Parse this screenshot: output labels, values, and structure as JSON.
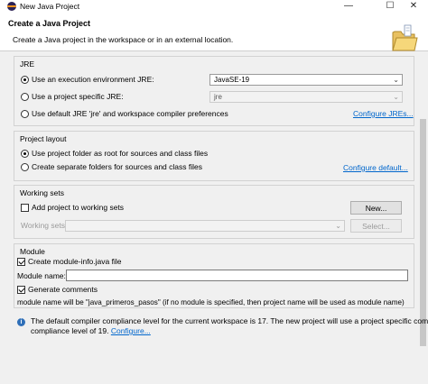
{
  "window": {
    "title": "New Java Project",
    "controls": {
      "minimize": "—",
      "maximize": "☐",
      "close": "✕"
    }
  },
  "header": {
    "title": "Create a Java Project",
    "description": "Create a Java project in the workspace or in an external location."
  },
  "jre": {
    "group_label": "JRE",
    "options": [
      {
        "label": "Use an execution environment JRE:",
        "selected": true
      },
      {
        "label": "Use a project specific JRE:",
        "selected": false
      },
      {
        "label": "Use default JRE 'jre' and workspace compiler preferences",
        "selected": false
      }
    ],
    "execution_env_value": "JavaSE-19",
    "project_jre_value": "jre",
    "configure_link": "Configure JREs..."
  },
  "project_layout": {
    "group_label": "Project layout",
    "options": [
      {
        "label": "Use project folder as root for sources and class files",
        "selected": true
      },
      {
        "label": "Create separate folders for sources and class files",
        "selected": false
      }
    ],
    "configure_link": "Configure default..."
  },
  "working_sets": {
    "group_label": "Working sets",
    "add_label": "Add project to working sets",
    "add_checked": false,
    "new_button": "New...",
    "working_sets_label": "Working sets:",
    "select_button": "Select..."
  },
  "module": {
    "group_label": "Module",
    "create_label": "Create module-info.java file",
    "create_checked": true,
    "name_label": "Module name:",
    "name_value": "",
    "generate_label": "Generate comments",
    "generate_checked": true,
    "module_note": "module name will be \"java_primeros_pasos\"  (if no module is specified, then project name will be used as module name)"
  },
  "info": {
    "line1": "The default compiler compliance level for the current workspace is 17. The new project will use a project specific compiler",
    "line2": "compliance level of 19.",
    "link": "Configure..."
  },
  "icons": {
    "app": "eclipse-icon",
    "wizard": "folder-icon",
    "info": "info-icon",
    "dropdown": "chevron-down-icon"
  }
}
